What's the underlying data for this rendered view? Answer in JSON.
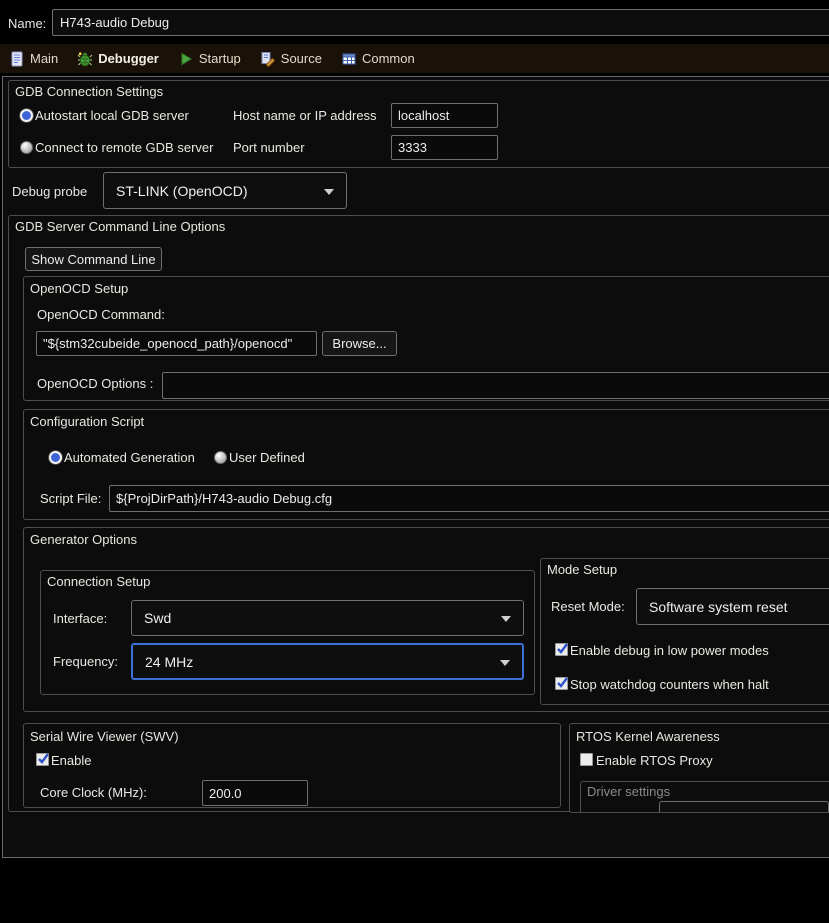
{
  "colors": {
    "accent": "#3e63d6",
    "tab_bar_bg": "#1a1208",
    "focus_border": "#3d6fd9"
  },
  "header": {
    "name_label": "Name:",
    "name_value": "H743-audio Debug"
  },
  "tabs": [
    {
      "label": "Main",
      "icon": "document-icon",
      "selected": false
    },
    {
      "label": "Debugger",
      "icon": "bug-icon",
      "selected": true
    },
    {
      "label": "Startup",
      "icon": "play-icon",
      "selected": false
    },
    {
      "label": "Source",
      "icon": "source-edit-icon",
      "selected": false
    },
    {
      "label": "Common",
      "icon": "table-icon",
      "selected": false
    }
  ],
  "gdb_connection": {
    "title": "GDB Connection Settings",
    "autostart_label": "Autostart local GDB server",
    "autostart_selected": true,
    "host_label": "Host name or IP address",
    "host_value": "localhost",
    "remote_label": "Connect to remote GDB server",
    "remote_selected": false,
    "port_label": "Port number",
    "port_value": "3333"
  },
  "debug_probe": {
    "label": "Debug probe",
    "value": "ST-LINK (OpenOCD)"
  },
  "gdb_server_options": {
    "title": "GDB Server Command Line Options",
    "show_command_line_button": "Show Command Line"
  },
  "openocd_setup": {
    "title": "OpenOCD Setup",
    "command_label": "OpenOCD Command:",
    "command_value": "\"${stm32cubeide_openocd_path}/openocd\"",
    "browse_button": "Browse...",
    "options_label": "OpenOCD Options :",
    "options_value": ""
  },
  "configuration_script": {
    "title": "Configuration Script",
    "automated_label": "Automated Generation",
    "automated_selected": true,
    "user_defined_label": "User Defined",
    "user_defined_selected": false,
    "script_file_label": "Script File:",
    "script_file_value": "${ProjDirPath}/H743-audio Debug.cfg"
  },
  "generator_options": {
    "title": "Generator Options",
    "connection_setup": {
      "title": "Connection Setup",
      "interface_label": "Interface:",
      "interface_value": "Swd",
      "frequency_label": "Frequency:",
      "frequency_value": "24 MHz",
      "frequency_focused": true
    },
    "mode_setup": {
      "title": "Mode Setup",
      "reset_mode_label": "Reset Mode:",
      "reset_mode_value": "Software system reset",
      "low_power_label": "Enable debug in low power modes",
      "low_power_checked": true,
      "watchdog_label": "Stop watchdog counters when halt",
      "watchdog_checked": true
    }
  },
  "swv": {
    "title": "Serial Wire Viewer (SWV)",
    "enable_label": "Enable",
    "enable_checked": true,
    "core_clock_label": "Core Clock (MHz):",
    "core_clock_value": "200.0"
  },
  "rtos": {
    "title": "RTOS Kernel Awareness",
    "enable_proxy_label": "Enable RTOS Proxy",
    "enable_proxy_checked": false,
    "driver_settings_title": "Driver settings"
  }
}
